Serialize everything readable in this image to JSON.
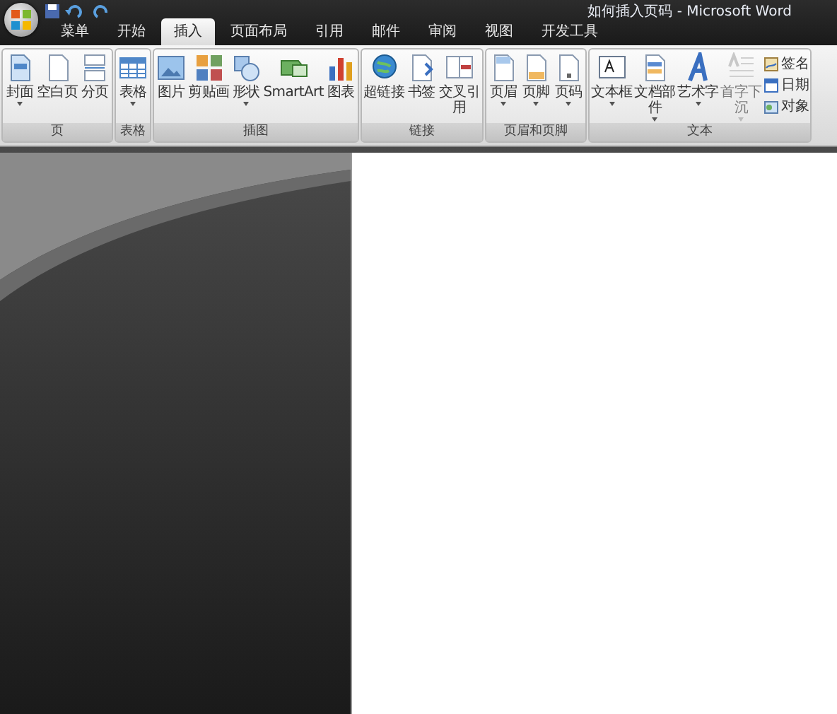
{
  "window": {
    "title": "如何插入页码 - Microsoft Word"
  },
  "tabs": [
    {
      "label": "菜单",
      "selected": false
    },
    {
      "label": "开始",
      "selected": false
    },
    {
      "label": "插入",
      "selected": true
    },
    {
      "label": "页面布局",
      "selected": false
    },
    {
      "label": "引用",
      "selected": false
    },
    {
      "label": "邮件",
      "selected": false
    },
    {
      "label": "审阅",
      "selected": false
    },
    {
      "label": "视图",
      "selected": false
    },
    {
      "label": "开发工具",
      "selected": false
    }
  ],
  "ribbon": {
    "groups": [
      {
        "label": "页",
        "buttons": [
          {
            "label": "封面",
            "kind": "cover",
            "dropdown": true,
            "disabled": false
          },
          {
            "label": "空白页",
            "kind": "page",
            "dropdown": false,
            "disabled": false
          },
          {
            "label": "分页",
            "kind": "break",
            "dropdown": false,
            "disabled": false
          }
        ]
      },
      {
        "label": "表格",
        "buttons": [
          {
            "label": "表格",
            "kind": "table",
            "dropdown": true,
            "disabled": false
          }
        ]
      },
      {
        "label": "插图",
        "buttons": [
          {
            "label": "图片",
            "kind": "picture",
            "dropdown": false,
            "disabled": false
          },
          {
            "label": "剪贴画",
            "kind": "clipart",
            "dropdown": false,
            "disabled": false
          },
          {
            "label": "形状",
            "kind": "shapes",
            "dropdown": true,
            "disabled": false
          },
          {
            "label": "SmartArt",
            "kind": "smartart",
            "dropdown": false,
            "disabled": false
          },
          {
            "label": "图表",
            "kind": "chart",
            "dropdown": false,
            "disabled": false
          }
        ]
      },
      {
        "label": "链接",
        "buttons": [
          {
            "label": "超链接",
            "kind": "globe",
            "dropdown": false,
            "disabled": false
          },
          {
            "label": "书签",
            "kind": "bookmark",
            "dropdown": false,
            "disabled": false
          },
          {
            "label": "交叉引用",
            "kind": "crossref",
            "dropdown": false,
            "disabled": false
          }
        ]
      },
      {
        "label": "页眉和页脚",
        "buttons": [
          {
            "label": "页眉",
            "kind": "header",
            "dropdown": true,
            "disabled": false
          },
          {
            "label": "页脚",
            "kind": "footer",
            "dropdown": true,
            "disabled": false
          },
          {
            "label": "页码",
            "kind": "pagenum",
            "dropdown": true,
            "disabled": false
          }
        ]
      },
      {
        "label": "文本",
        "buttons": [
          {
            "label": "文本框",
            "kind": "textbox",
            "dropdown": true,
            "disabled": false
          },
          {
            "label": "文档部件",
            "kind": "parts",
            "dropdown": true,
            "disabled": false
          },
          {
            "label": "艺术字",
            "kind": "wordart",
            "dropdown": true,
            "disabled": false
          },
          {
            "label": "首字下沉",
            "kind": "dropcap",
            "dropdown": true,
            "disabled": true
          }
        ],
        "small_buttons": [
          {
            "label": "签名",
            "kind": "signature"
          },
          {
            "label": "日期",
            "kind": "date"
          },
          {
            "label": "对象",
            "kind": "object"
          }
        ]
      }
    ]
  }
}
